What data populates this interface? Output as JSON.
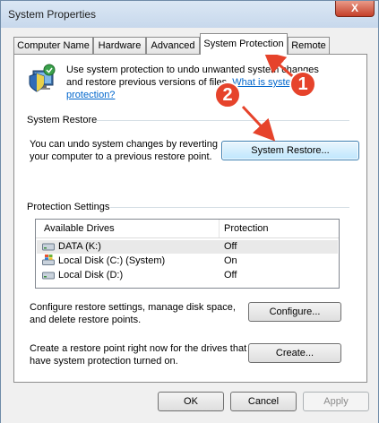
{
  "window": {
    "title": "System Properties",
    "close_glyph": "X"
  },
  "tabs": [
    {
      "label": "Computer Name"
    },
    {
      "label": "Hardware"
    },
    {
      "label": "Advanced"
    },
    {
      "label": "System Protection"
    },
    {
      "label": "Remote"
    }
  ],
  "intro": {
    "text": "Use system protection to undo unwanted system changes and restore previous versions of files.",
    "link": "What is system protection?"
  },
  "system_restore": {
    "title": "System Restore",
    "description": "You can undo system changes by reverting your computer to a previous restore point.",
    "button": "System Restore..."
  },
  "protection": {
    "title": "Protection Settings",
    "columns": [
      "Available Drives",
      "Protection"
    ],
    "rows": [
      {
        "drive": "DATA (K:)",
        "protection": "Off",
        "icon": "drive-icon"
      },
      {
        "drive": "Local Disk (C:) (System)",
        "protection": "On",
        "icon": "windows-drive-icon"
      },
      {
        "drive": "Local Disk (D:)",
        "protection": "Off",
        "icon": "drive-icon"
      }
    ],
    "configure_text": "Configure restore settings, manage disk space, and delete restore points.",
    "configure_button": "Configure...",
    "create_text": "Create a restore point right now for the drives that have system protection turned on.",
    "create_button": "Create..."
  },
  "footer": {
    "ok": "OK",
    "cancel": "Cancel",
    "apply": "Apply"
  },
  "annotations": {
    "badge1": "1",
    "badge2": "2",
    "color": "#e6432b"
  }
}
